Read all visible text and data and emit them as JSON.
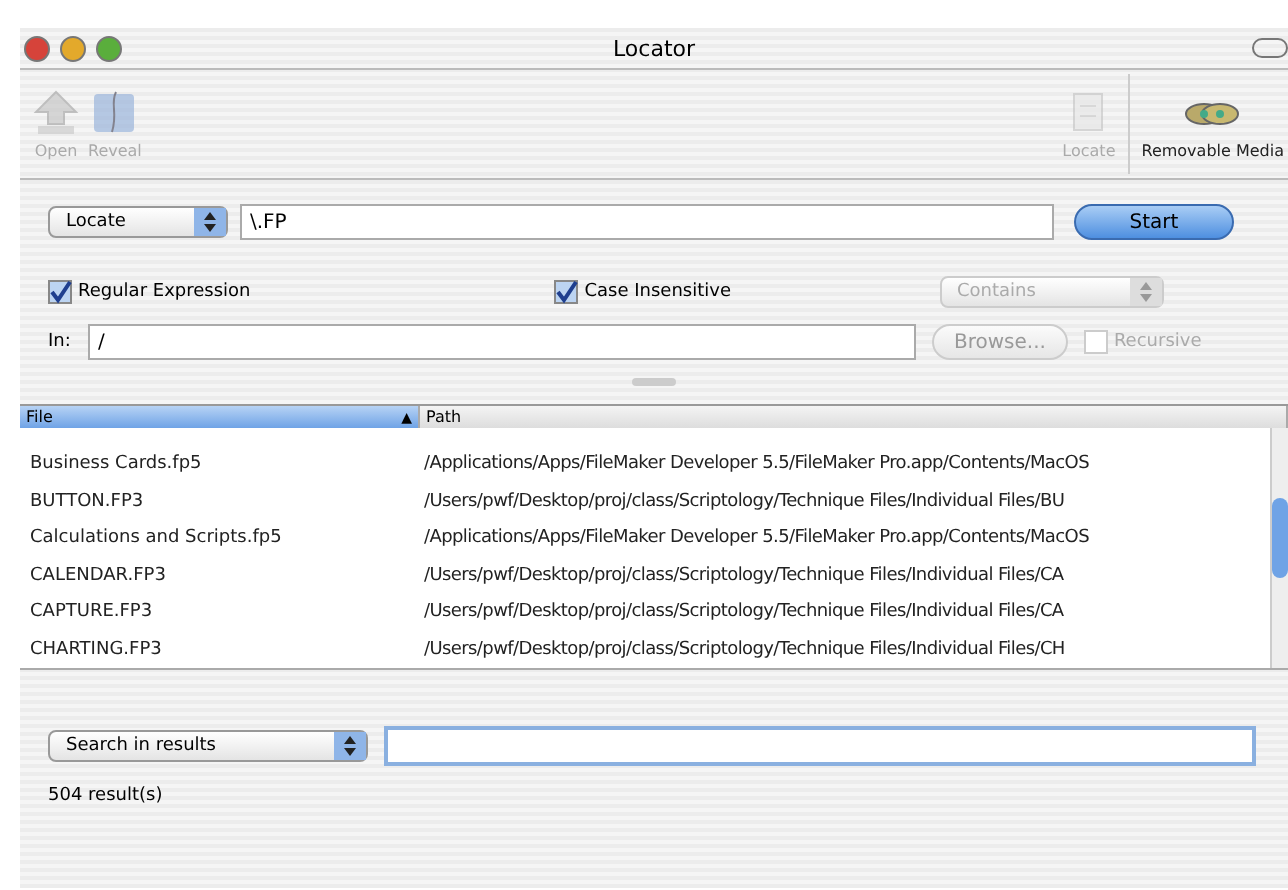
{
  "window": {
    "title": "Locator"
  },
  "toolbar": {
    "items": [
      {
        "label": "Open",
        "kind": "open",
        "disabled": true
      },
      {
        "label": "Reveal",
        "kind": "reveal",
        "disabled": true
      },
      {
        "label": "Locate",
        "kind": "locate",
        "disabled": true
      },
      {
        "label": "Removable Media",
        "kind": "media",
        "disabled": false
      }
    ]
  },
  "search": {
    "mode": "Locate",
    "value": "\\.FP",
    "start_button": "Start"
  },
  "options": {
    "regular_expression": {
      "label": "Regular Expression",
      "checked": true
    },
    "case_insensitive": {
      "label": "Case Insensitive",
      "checked": true
    },
    "match": {
      "value": "Contains",
      "disabled": true
    }
  },
  "location": {
    "label": "In:",
    "value": "/",
    "browse_button": {
      "label": "Browse...",
      "disabled": true
    },
    "recursive": {
      "label": "Recursive",
      "checked": false,
      "disabled": true
    }
  },
  "table": {
    "columns": [
      {
        "label": "File",
        "selected": true,
        "sort": "▲"
      },
      {
        "label": "Path",
        "selected": false
      }
    ],
    "rows": [
      {
        "file": "Business Cards.fp5",
        "path": "/Applications/Apps/FileMaker Developer 5.5/FileMaker Pro.app/Contents/MacOS"
      },
      {
        "file": "BUTTON.FP3",
        "path": "/Users/pwf/Desktop/proj/class/Scriptology/Technique Files/Individual Files/BU"
      },
      {
        "file": "Calculations and Scripts.fp5",
        "path": "/Applications/Apps/FileMaker Developer 5.5/FileMaker Pro.app/Contents/MacOS"
      },
      {
        "file": "CALENDAR.FP3",
        "path": "/Users/pwf/Desktop/proj/class/Scriptology/Technique Files/Individual Files/CA"
      },
      {
        "file": "CAPTURE.FP3",
        "path": "/Users/pwf/Desktop/proj/class/Scriptology/Technique Files/Individual Files/CA"
      },
      {
        "file": "CHARTING.FP3",
        "path": "/Users/pwf/Desktop/proj/class/Scriptology/Technique Files/Individual Files/CH"
      }
    ]
  },
  "filter": {
    "mode": "Search in results"
  },
  "status_bar": {
    "count": "504 result(s)"
  }
}
